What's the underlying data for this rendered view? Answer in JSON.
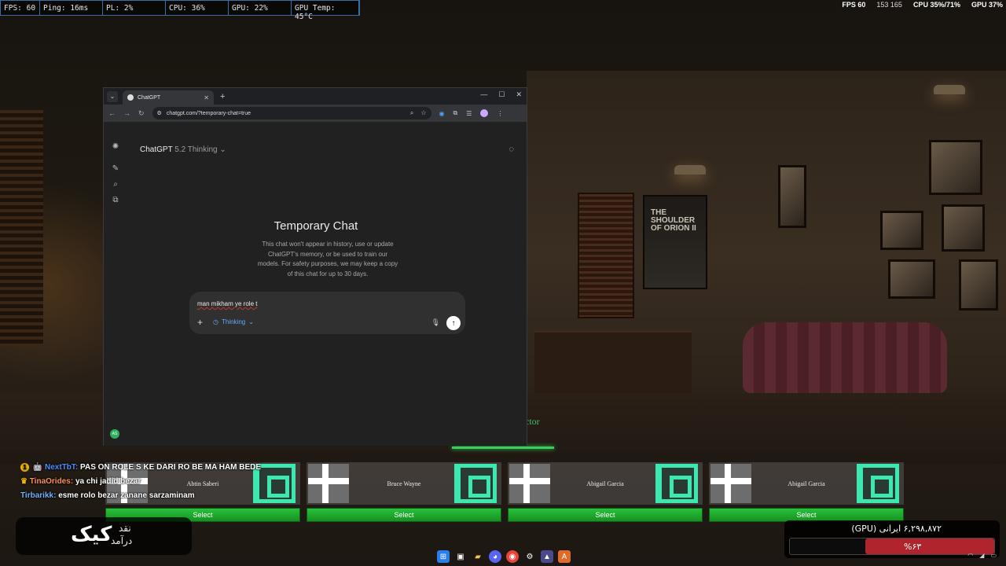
{
  "overlay_stats": [
    "FPS: 60",
    "Ping: 16ms",
    "PL: 2%",
    "CPU: 36%",
    "GPU: 22%",
    "GPU Temp: 45°C"
  ],
  "top_right_stats": {
    "fps": "FPS 60",
    "frames": "153 165",
    "cpu": "CPU 35%/71%",
    "gpu": "GPU 37%"
  },
  "browser": {
    "tab_title": "ChatGPT",
    "url": "chatgpt.com/?temporary-chat=true"
  },
  "chatgpt": {
    "model_name": "ChatGPT",
    "model_version": "5.2 Thinking",
    "title": "Temporary Chat",
    "description": "This chat won't appear in history, use or update ChatGPT's memory, or be used to train our models. For safety purposes, we may keep a copy of this chat for up to 30 days.",
    "composer_text": "man mikham ye role t",
    "thinking_label": "Thinking",
    "user_initials": "AS"
  },
  "game": {
    "poster_text": "THE SHOULDER OF ORION II",
    "director_label": "ctor"
  },
  "cards": [
    {
      "name": "Abtin Saberi",
      "select": "Select"
    },
    {
      "name": "Bruce Wayne",
      "select": "Select"
    },
    {
      "name": "Abigail Garcia",
      "select": "Select"
    },
    {
      "name": "Abigail Garcia",
      "select": "Select"
    }
  ],
  "stream_chat": [
    {
      "user": "NextTbT",
      "message": "PAS ON ROLE S KE DARI RO BE MA HAM BEDE"
    },
    {
      "user": "TinaOrides",
      "message": "ya chi jadid bezar"
    },
    {
      "user": "Tirbarikk",
      "message": "esme rolo bezar zanane sarzaminam"
    }
  ],
  "donate_widget": {
    "big": "کیک",
    "top": "نقد",
    "bottom": "درآمد"
  },
  "gpu_widget": {
    "title": "۶,۲۹۸,۸۷۲ ایرانی (GPU)",
    "percent_label": "%۶۳",
    "fill_percent": 63,
    "fill_color": "#b0242e"
  },
  "colors": {
    "accent_green": "#36d15a",
    "chat_link_blue": "#66a8ff"
  }
}
